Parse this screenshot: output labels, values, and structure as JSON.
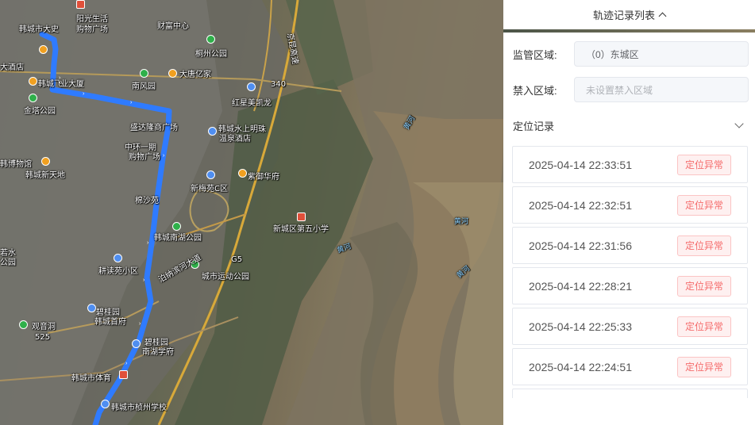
{
  "map": {
    "labels": [
      {
        "id": "hancheng-dashi",
        "text": "韩城市大史",
        "cls": ""
      },
      {
        "id": "yangguang",
        "text": "阳光生活",
        "cls": ""
      },
      {
        "id": "gouwu1",
        "text": "购物广场",
        "cls": ""
      },
      {
        "id": "caifu",
        "text": "财富中心",
        "cls": ""
      },
      {
        "id": "tongzhou",
        "text": "桐州公园",
        "cls": ""
      },
      {
        "id": "dajiudian",
        "text": "大酒店",
        "cls": ""
      },
      {
        "id": "hanchengfei",
        "text": "韩城飞",
        "cls": ""
      },
      {
        "id": "shangye",
        "text": "业大厦",
        "cls": ""
      },
      {
        "id": "nanfeng",
        "text": "南风园",
        "cls": ""
      },
      {
        "id": "dayijiang",
        "text": "大唐亿家",
        "cls": ""
      },
      {
        "id": "jinta",
        "text": "金塔公园",
        "cls": ""
      },
      {
        "id": "hongxing",
        "text": "红星美凯龙",
        "cls": ""
      },
      {
        "id": "shengdalong",
        "text": "盛达隆商广场",
        "cls": ""
      },
      {
        "id": "shuishang",
        "text": "韩城水上明珠",
        "cls": ""
      },
      {
        "id": "wenquan",
        "text": "温泉酒店",
        "cls": ""
      },
      {
        "id": "zhonghuan",
        "text": "中环一期",
        "cls": ""
      },
      {
        "id": "gouwu2",
        "text": "购物广场",
        "cls": ""
      },
      {
        "id": "bowuguan",
        "text": "韩博物馆",
        "cls": ""
      },
      {
        "id": "xintiandi",
        "text": "韩城新天地",
        "cls": ""
      },
      {
        "id": "ziyuhuafu",
        "text": "紫御华府",
        "cls": ""
      },
      {
        "id": "xinmeiyuan",
        "text": "新梅苑C区",
        "cls": ""
      },
      {
        "id": "miansha",
        "text": "棉沙苑",
        "cls": ""
      },
      {
        "id": "nanhu",
        "text": "韩城南湖公园",
        "cls": ""
      },
      {
        "id": "xiaoxue",
        "text": "新城区第五小学",
        "cls": ""
      },
      {
        "id": "gengjiyuan",
        "text": "耕读苑小区",
        "cls": ""
      },
      {
        "id": "yundong",
        "text": "城市运动公园",
        "cls": ""
      },
      {
        "id": "biguiyuan",
        "text": "碧桂园",
        "cls": ""
      },
      {
        "id": "shoufu",
        "text": "韩城首府",
        "cls": ""
      },
      {
        "id": "guanyinjian",
        "text": "观音洞",
        "cls": ""
      },
      {
        "id": "biguiyuan2",
        "text": "碧桂园",
        "cls": ""
      },
      {
        "id": "nanhushoufu",
        "text": "南湖学府",
        "cls": ""
      },
      {
        "id": "tiyu",
        "text": "韩城市体育",
        "cls": ""
      },
      {
        "id": "xuexiao",
        "text": "韩城市桢州学校",
        "cls": ""
      },
      {
        "id": "ruoshui",
        "text": "若水",
        "cls": ""
      },
      {
        "id": "gongyuan",
        "text": "公园",
        "cls": ""
      },
      {
        "id": "jingbei",
        "text": "京昆高速",
        "cls": ""
      },
      {
        "id": "g5",
        "text": "G5",
        "cls": ""
      },
      {
        "id": "huanghe1",
        "text": "黄河",
        "cls": "river"
      },
      {
        "id": "huanghe2",
        "text": "黄河",
        "cls": "river"
      },
      {
        "id": "huanghe3",
        "text": "黄河",
        "cls": "river"
      },
      {
        "id": "huanghe4",
        "text": "黄河",
        "cls": "river"
      },
      {
        "id": "s340",
        "text": "340",
        "cls": ""
      },
      {
        "id": "s525",
        "text": "525",
        "cls": ""
      },
      {
        "id": "yumenkou",
        "text": "泊纳滨河大道",
        "cls": ""
      }
    ]
  },
  "panel": {
    "header_title": "轨迹记录列表",
    "supervision_label": "监管区域:",
    "supervision_value": "（0）东城区",
    "forbidden_label": "禁入区域:",
    "forbidden_placeholder": "未设置禁入区域",
    "records_label": "定位记录",
    "records": [
      {
        "time": "2025-04-14 22:33:51",
        "status": "定位异常"
      },
      {
        "time": "2025-04-14 22:32:51",
        "status": "定位异常"
      },
      {
        "time": "2025-04-14 22:31:56",
        "status": "定位异常"
      },
      {
        "time": "2025-04-14 22:28:21",
        "status": "定位异常"
      },
      {
        "time": "2025-04-14 22:25:33",
        "status": "定位异常"
      },
      {
        "time": "2025-04-14 22:24:51",
        "status": "定位异常"
      },
      {
        "time": "",
        "status": ""
      }
    ]
  },
  "colors": {
    "route": "#2f7bff",
    "badge_text": "#f56c6c",
    "badge_bg": "#fef0f0"
  }
}
